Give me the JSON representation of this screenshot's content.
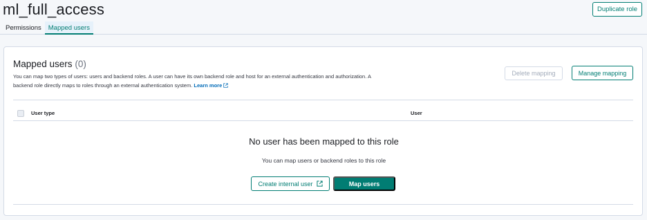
{
  "header": {
    "title": "ml_full_access",
    "duplicate_label": "Duplicate role"
  },
  "tabs": [
    {
      "label": "Permissions",
      "active": false
    },
    {
      "label": "Mapped users",
      "active": true
    }
  ],
  "panel": {
    "title": "Mapped users",
    "count": "(0)",
    "description": "You can map two types of users: users and backend roles. A user can have its own backend role and host for an external authentication and authorization. A backend role directly maps to roles through an external authentication system.",
    "learn_more": "Learn more",
    "delete_label": "Delete mapping",
    "manage_label": "Manage mapping"
  },
  "table": {
    "columns": [
      "User type",
      "User"
    ]
  },
  "empty": {
    "title": "No user has been mapped to this role",
    "subtitle": "You can map users or backend roles to this role",
    "create_label": "Create internal user",
    "map_label": "Map users"
  },
  "colors": {
    "accent": "#017d73",
    "link": "#006bb8",
    "border": "#d3dae6"
  },
  "icons": [
    "external-link-icon"
  ]
}
